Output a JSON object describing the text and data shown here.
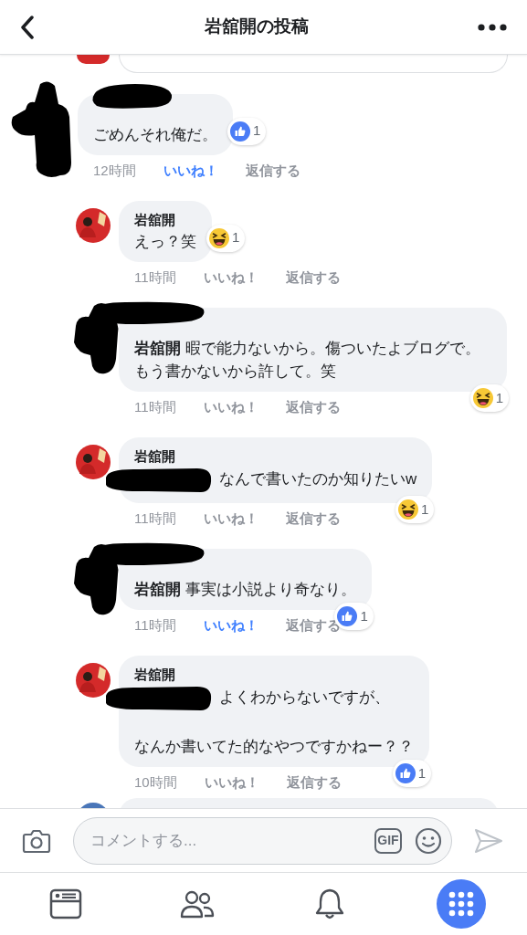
{
  "header": {
    "title": "岩舘開の投稿"
  },
  "comments": [
    {
      "kind": "top",
      "name_redacted": true,
      "paragraphs": [
        "ごめんそれ俺だ。"
      ],
      "time": "12時間",
      "like_label": "いいね！",
      "liked": true,
      "reply_label": "返信する",
      "reaction": {
        "kind": "like",
        "count": "1"
      }
    },
    {
      "kind": "reply",
      "name": "岩舘開",
      "paragraphs": [
        "えっ？笑"
      ],
      "time": "11時間",
      "like_label": "いいね！",
      "liked": false,
      "reply_label": "返信する",
      "reaction": {
        "kind": "haha",
        "count": "1"
      }
    },
    {
      "kind": "reply",
      "name_redacted": true,
      "paragraphs": [
        "**岩舘開** 暇で能力ないから。傷ついたよブログで。もう書かないから許して。笑"
      ],
      "time": "11時間",
      "like_label": "いいね！",
      "liked": false,
      "reply_label": "返信する",
      "reaction": {
        "kind": "haha",
        "count": "1"
      }
    },
    {
      "kind": "reply",
      "name": "岩舘開",
      "mention_redacted": true,
      "paragraphs": [
        "なんで書いたのか知りたいw"
      ],
      "time": "11時間",
      "like_label": "いいね！",
      "liked": false,
      "reply_label": "返信する",
      "reaction": {
        "kind": "haha",
        "count": "1"
      }
    },
    {
      "kind": "reply",
      "name_redacted": true,
      "paragraphs": [
        "**岩舘開** 事実は小説より奇なり。"
      ],
      "time": "11時間",
      "like_label": "いいね！",
      "liked": true,
      "reply_label": "返信する",
      "reaction": {
        "kind": "like",
        "count": "1"
      }
    },
    {
      "kind": "reply",
      "name": "岩舘開",
      "mention_redacted": true,
      "paragraphs": [
        "よくわからないですが、",
        "なんか書いてた的なやつですかねー？？"
      ],
      "time": "10時間",
      "like_label": "いいね！",
      "liked": false,
      "reply_label": "返信する",
      "reaction": {
        "kind": "like",
        "count": "1"
      }
    }
  ],
  "composer": {
    "placeholder": "コメントする...",
    "gif_label": "GIF"
  },
  "tabs": [
    {
      "kind": "feed",
      "selected": false
    },
    {
      "kind": "friends",
      "selected": false
    },
    {
      "kind": "notifications",
      "selected": false
    },
    {
      "kind": "menu",
      "selected": true
    }
  ]
}
